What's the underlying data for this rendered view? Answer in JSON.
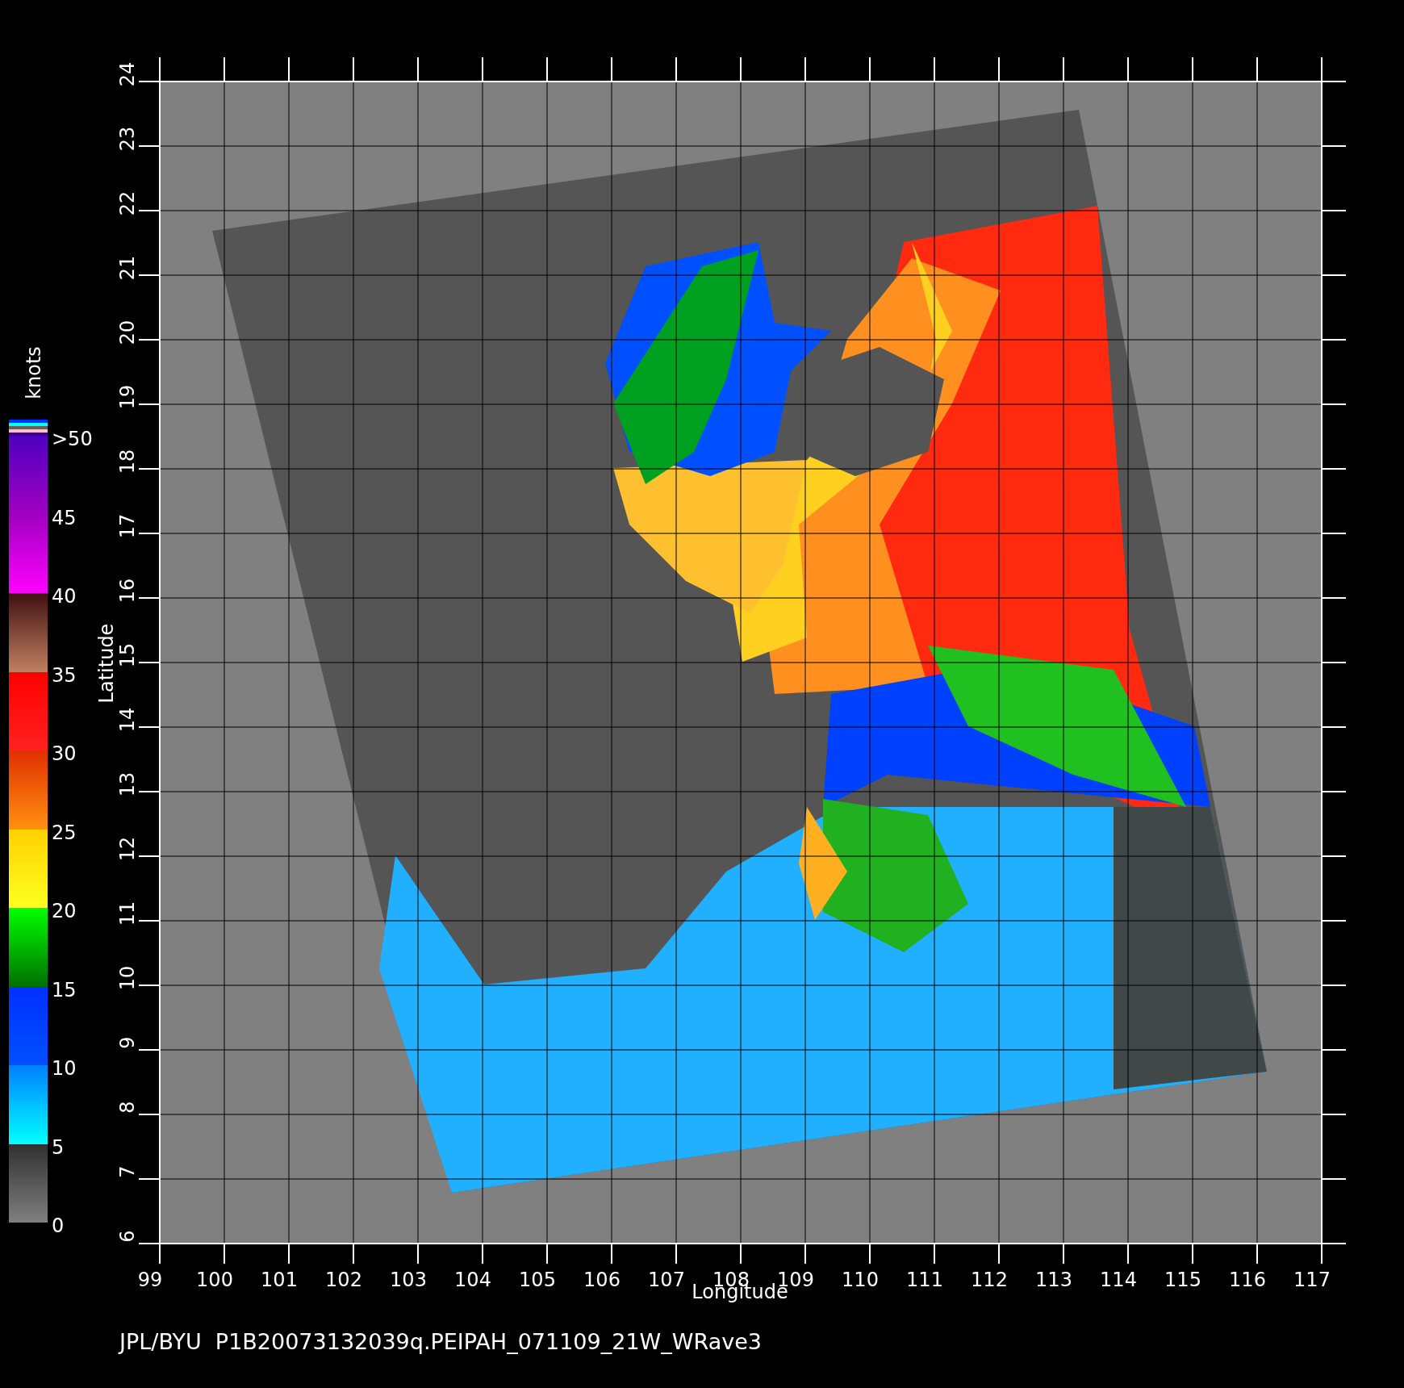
{
  "map": {
    "xlabel": "Longitude",
    "ylabel": "Latitude",
    "xticks": [
      "99",
      "100",
      "101",
      "102",
      "103",
      "104",
      "105",
      "106",
      "107",
      "108",
      "109",
      "110",
      "111",
      "112",
      "113",
      "114",
      "115",
      "116",
      "117"
    ],
    "yticks": [
      "6",
      "7",
      "8",
      "9",
      "10",
      "11",
      "12",
      "13",
      "14",
      "15",
      "16",
      "17",
      "18",
      "19",
      "20",
      "21",
      "22",
      "23",
      "24"
    ]
  },
  "colorbar": {
    "title": "knots",
    "labels": [
      ">50",
      "45",
      "40",
      "35",
      "30",
      "25",
      "20",
      "15",
      "10",
      "5",
      "0"
    ]
  },
  "footer": "JPL/BYU  P1B20073132039q.PEIPAH_071109_21W_WRave3"
}
